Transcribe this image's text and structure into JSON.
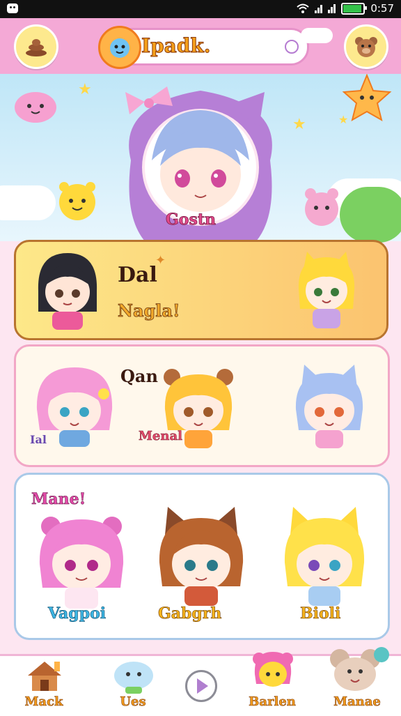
{
  "status_bar": {
    "time": "0:57"
  },
  "header": {
    "logo_text": "Ipadk."
  },
  "hero": {
    "name": "Gostn"
  },
  "card_row_1": {
    "label_top": "Dal",
    "label_bottom": "Nagla!"
  },
  "card_row_2": {
    "label_top": "Qan",
    "label_left": "Ial",
    "label_mid": "Menal"
  },
  "card_row_3": {
    "title": "Mane!",
    "names": [
      "Vagpoi",
      "Gabgrh",
      "Bioli"
    ]
  },
  "bottom_nav": {
    "items": [
      "Mack",
      "Ues",
      "Barlen",
      "Manae"
    ]
  },
  "colors": {
    "header_bg": "#f4a9d6",
    "accent_yellow": "#fde98e",
    "brand_pink": "#e24a8b"
  },
  "icons": [
    "wifi-icon",
    "signal-icon",
    "battery-icon",
    "bear-icon",
    "poop-icon",
    "play-icon",
    "house-icon"
  ]
}
